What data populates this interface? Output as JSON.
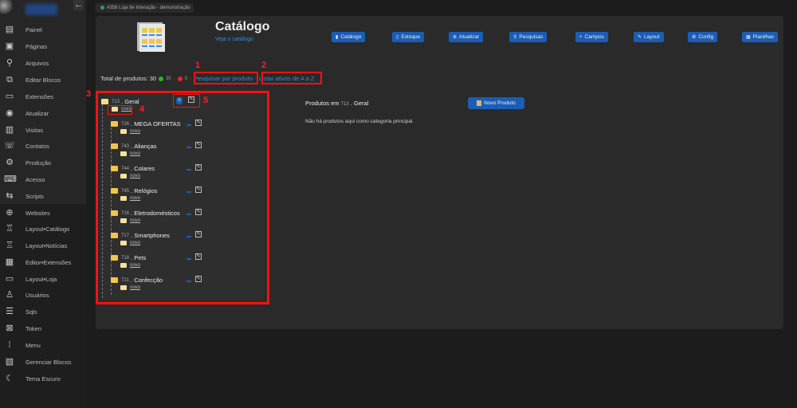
{
  "sidebar": {
    "back_icon": "arrow-left-icon",
    "items": [
      {
        "label": "Painel",
        "icon": "dashboard-icon"
      },
      {
        "label": "Páginas",
        "icon": "pages-icon"
      },
      {
        "label": "Arquivos",
        "icon": "paperclip-icon"
      },
      {
        "label": "Editar Blocos",
        "icon": "blocks-icon"
      },
      {
        "label": "Extensões",
        "icon": "extensions-icon"
      },
      {
        "label": "Atualizar",
        "icon": "refresh-icon"
      },
      {
        "label": "Visitas",
        "icon": "chart-icon"
      },
      {
        "label": "Contatos",
        "icon": "contacts-icon"
      },
      {
        "label": "Produção",
        "icon": "production-icon"
      },
      {
        "label": "Acesso",
        "icon": "access-icon"
      },
      {
        "label": "Scripts",
        "icon": "scripts-icon"
      },
      {
        "label": "Websites",
        "icon": "globe-icon"
      },
      {
        "label": "Layout•Catálogo",
        "icon": "layout-icon"
      },
      {
        "label": "Layout•Notícias",
        "icon": "layout-icon"
      },
      {
        "label": "Editor•Extensões",
        "icon": "editor-icon"
      },
      {
        "label": "Layout•Loja",
        "icon": "store-icon"
      },
      {
        "label": "Usuários",
        "icon": "user-icon"
      },
      {
        "label": "Sqls",
        "icon": "database-icon"
      },
      {
        "label": "Token",
        "icon": "token-icon"
      },
      {
        "label": "Menu",
        "icon": "grid-icon"
      },
      {
        "label": "Gerenciar Blocos",
        "icon": "manage-blocks-icon"
      },
      {
        "label": "Tema Escuro",
        "icon": "moon-icon"
      }
    ]
  },
  "site_pill": "#358 Loja de Interação - demonstração",
  "header": {
    "title": "Catálogo",
    "subtitle": "Veja o catálogo"
  },
  "toolbar": [
    {
      "label": "Catálogo",
      "icon": "book-icon"
    },
    {
      "label": "Estoque",
      "icon": "box-icon"
    },
    {
      "label": "Atualizar",
      "icon": "globe-icon"
    },
    {
      "label": "Pesquisas",
      "icon": "search-icon"
    },
    {
      "label": "Campos",
      "icon": "plus-icon"
    },
    {
      "label": "Layout",
      "icon": "pencil-icon"
    },
    {
      "label": "Config",
      "icon": "gear-icon"
    },
    {
      "label": "Planilhas",
      "icon": "spreadsheet-icon"
    }
  ],
  "totals": {
    "label": "Total de produtos: 30",
    "active": "30",
    "inactive": "0",
    "search_link": "Pesquisar por produto",
    "list_link": "Listar ativos de A a Z",
    "sep": "·"
  },
  "colors": {
    "active": "#22bb22",
    "inactive": "#ee2222",
    "accent": "#1b5db5",
    "annotation": "#ff1010"
  },
  "tree": {
    "root": {
      "id": "713",
      "name": "Geral",
      "count": "0",
      "novo": "novo"
    },
    "children": [
      {
        "id": "726",
        "name": "MEGA OFERTAS",
        "novo": "novo"
      },
      {
        "id": "743",
        "name": "Alianças",
        "novo": "novo"
      },
      {
        "id": "744",
        "name": "Colares",
        "novo": "novo"
      },
      {
        "id": "745",
        "name": "Relógios",
        "novo": "novo"
      },
      {
        "id": "716",
        "name": "Eletrodomésticos",
        "novo": "novo"
      },
      {
        "id": "717",
        "name": "Smartphones",
        "novo": "novo"
      },
      {
        "id": "718",
        "name": "Pets",
        "novo": "novo"
      },
      {
        "id": "721",
        "name": "Confecção",
        "novo": "novo"
      }
    ]
  },
  "products": {
    "label": "Produtos em",
    "category_id": "713",
    "category_name": ". Geral",
    "new_button": "Novo Produto",
    "empty": "Não há produtos aqui como categoria principal."
  },
  "annotations": [
    "1",
    "2",
    "3",
    "4",
    "5"
  ]
}
